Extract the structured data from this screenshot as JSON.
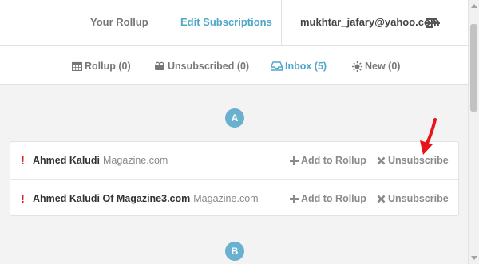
{
  "header": {
    "rollup_label": "Your Rollup",
    "edit_label": "Edit Subscriptions",
    "email": "mukhtar_jafary@yahoo.com"
  },
  "tabs": [
    {
      "label": "Rollup (0)",
      "icon": "calendar-icon"
    },
    {
      "label": "Unsubscribed (0)",
      "icon": "bomb-icon"
    },
    {
      "label": "Inbox (5)",
      "icon": "inbox-icon",
      "active": true
    },
    {
      "label": "New (0)",
      "icon": "sun-icon"
    }
  ],
  "groups": [
    {
      "letter": "A"
    },
    {
      "letter": "B"
    }
  ],
  "rows": [
    {
      "flag": "!",
      "name": "Ahmed Kaludi",
      "source": "Magazine.com",
      "add_label": "Add to Rollup",
      "unsub_label": "Unsubscribe"
    },
    {
      "flag": "!",
      "name": "Ahmed Kaludi Of Magazine3.com",
      "source": "Magazine.com",
      "add_label": "Add to Rollup",
      "unsub_label": "Unsubscribe"
    }
  ],
  "colors": {
    "accent": "#4ea7c9",
    "letter_circle": "#6ab0cf",
    "flag": "#d9252b",
    "annotation_arrow": "#e8141a"
  }
}
